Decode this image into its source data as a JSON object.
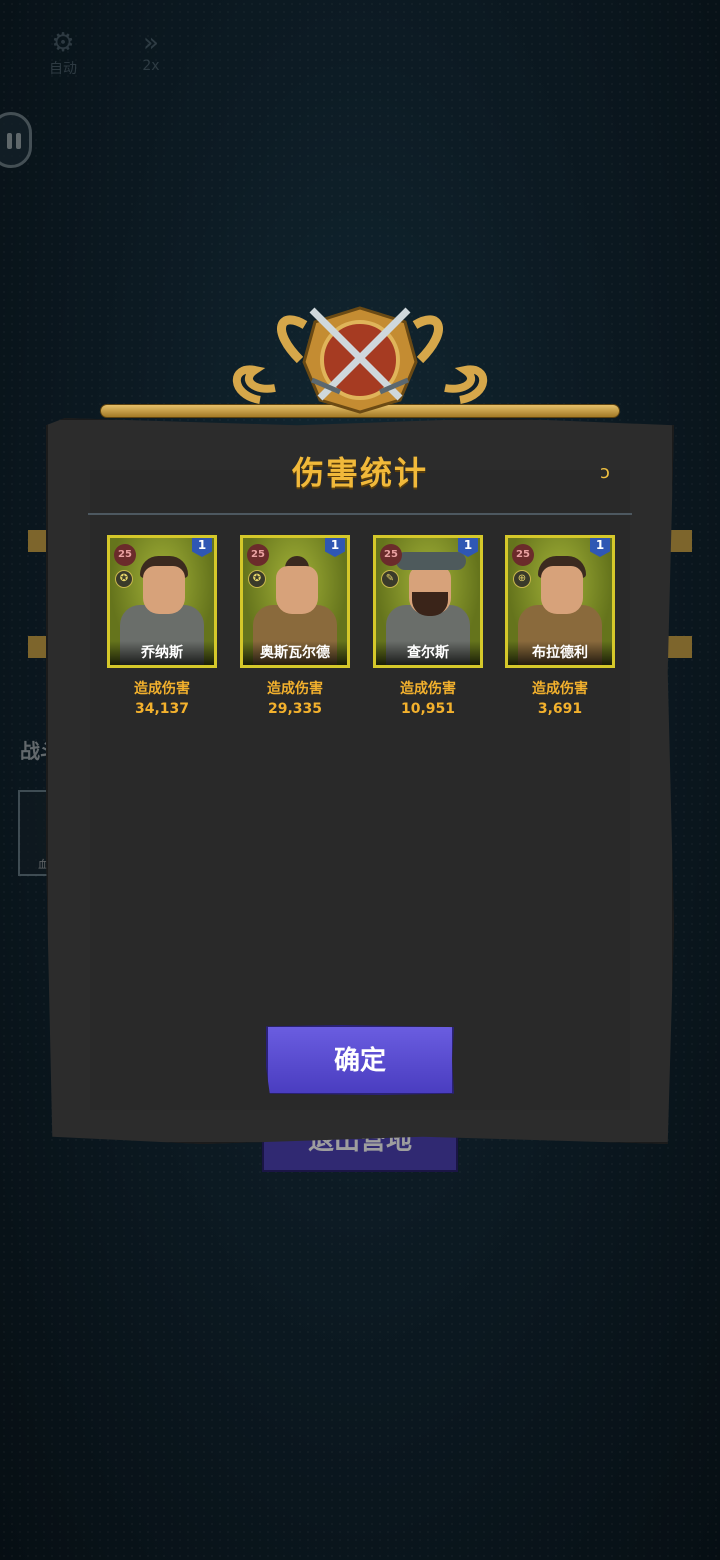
{
  "hud": {
    "auto_label": "自动",
    "speed_label": "2x"
  },
  "background": {
    "side_text": "战斗",
    "thumb_text": "血",
    "underlay_button": "退出营地"
  },
  "dialog": {
    "title": "伤害统计",
    "damage_label": "造成伤害",
    "confirm_label": "确定",
    "heroes": [
      {
        "name": "乔纳斯",
        "level": "25",
        "stars": "1",
        "damage": "34,137"
      },
      {
        "name": "奥斯瓦尔德",
        "level": "25",
        "stars": "1",
        "damage": "29,335"
      },
      {
        "name": "查尔斯",
        "level": "25",
        "stars": "1",
        "damage": "10,951"
      },
      {
        "name": "布拉德利",
        "level": "25",
        "stars": "1",
        "damage": "3,691"
      }
    ]
  },
  "colors": {
    "title": "#f1b93a",
    "damage_text": "#f3b12d",
    "card_border": "#d5c82a",
    "confirm_button": "#5a4ed0",
    "panel": "#2c2c2c"
  }
}
